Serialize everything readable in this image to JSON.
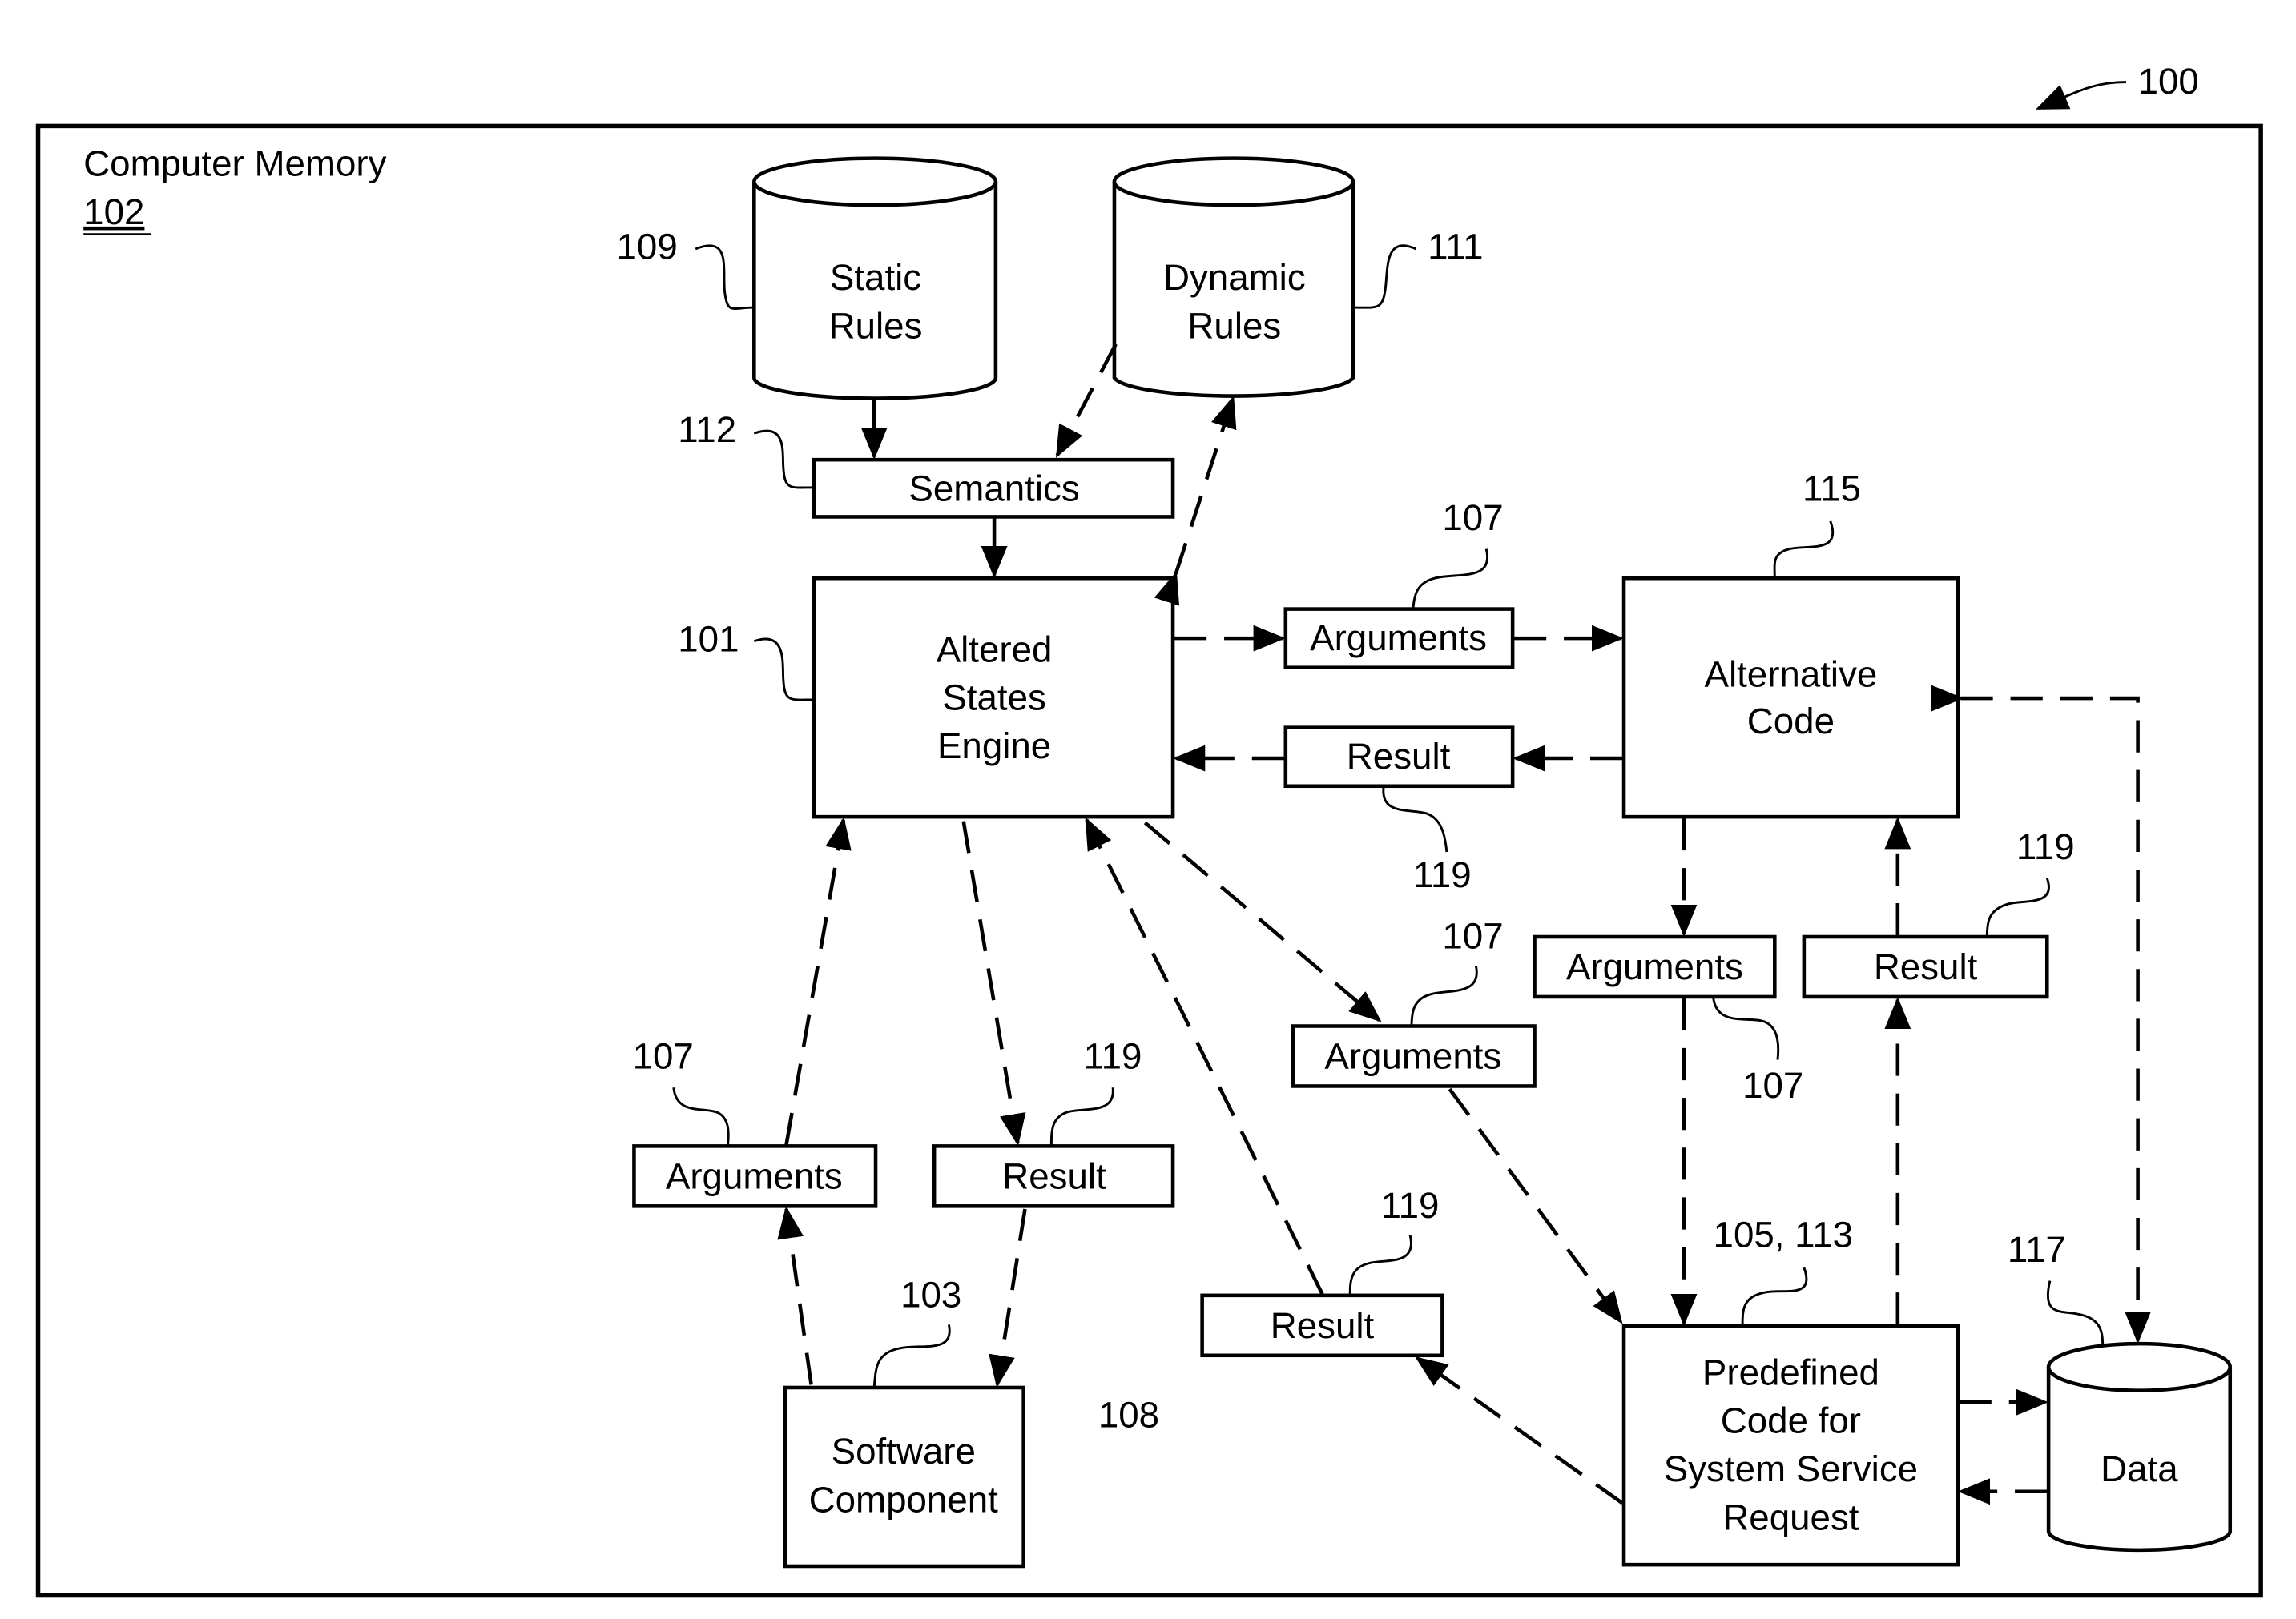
{
  "figure": {
    "ref": "100",
    "container": {
      "label": "Computer Memory",
      "ref": "102"
    }
  },
  "nodes": {
    "static_rules": {
      "lines": [
        "Static",
        "Rules"
      ],
      "ref": "109"
    },
    "dynamic_rules": {
      "lines": [
        "Dynamic",
        "Rules"
      ],
      "ref": "111"
    },
    "semantics": {
      "label": "Semantics",
      "ref": "112"
    },
    "engine": {
      "lines": [
        "Altered",
        "States",
        "Engine"
      ],
      "ref": "101"
    },
    "alt_code": {
      "lines": [
        "Alternative",
        "Code"
      ],
      "ref": "115"
    },
    "software": {
      "lines": [
        "Software",
        "Component"
      ],
      "ref": "103"
    },
    "predefined": {
      "lines": [
        "Predefined",
        "Code for",
        "System Service",
        "Request"
      ],
      "ref": "105, 113"
    },
    "data": {
      "label": "Data",
      "ref": "117"
    },
    "label_108": "108"
  },
  "messages": {
    "args_engine_alt": {
      "label": "Arguments",
      "ref": "107"
    },
    "result_alt_engine": {
      "label": "Result",
      "ref": "119"
    },
    "args_alt_pre": {
      "label": "Arguments",
      "ref": "107"
    },
    "result_pre_alt": {
      "label": "Result",
      "ref": "119"
    },
    "args_engine_pre": {
      "label": "Arguments",
      "ref": "107"
    },
    "result_pre_engine": {
      "label": "Result",
      "ref": "119"
    },
    "args_sw_engine": {
      "label": "Arguments",
      "ref": "107"
    },
    "result_engine_sw": {
      "label": "Result",
      "ref": "119"
    }
  }
}
